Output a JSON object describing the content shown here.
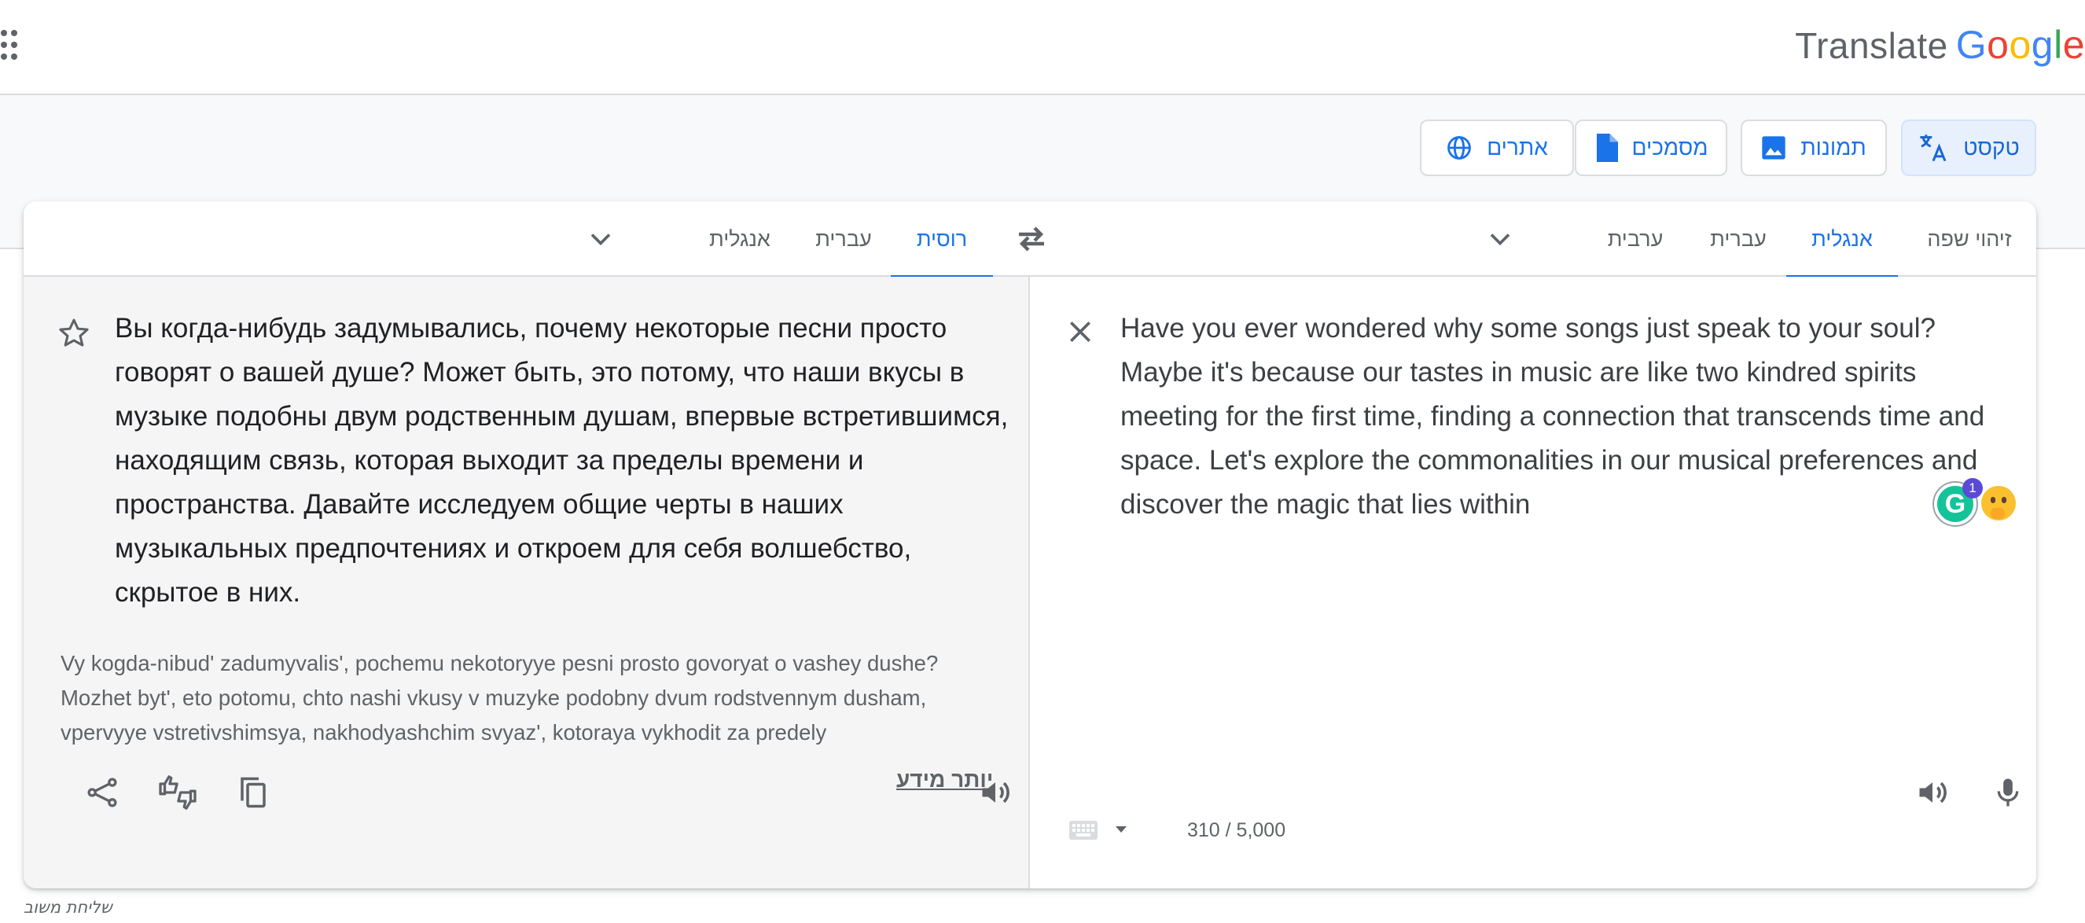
{
  "header": {
    "brand_translate": "Translate",
    "brand_google_letters": [
      "G",
      "o",
      "o",
      "g",
      "l",
      "e"
    ],
    "brand_colors": [
      "#4285f4",
      "#ea4335",
      "#fbbc05",
      "#4285f4",
      "#34a853",
      "#ea4335"
    ]
  },
  "modes": {
    "text": "טקסט",
    "images": "תמונות",
    "documents": "מסמכים",
    "websites": "אתרים"
  },
  "source_langs": {
    "detect": "זיהוי שפה",
    "english": "אנגלית",
    "hebrew": "עברית",
    "arabic": "ערבית"
  },
  "target_langs": {
    "russian": "רוסית",
    "hebrew": "עברית",
    "english": "אנגלית"
  },
  "source": {
    "text": "Have you ever wondered why some songs just speak to your soul? Maybe it's because our tastes in music are like two kindred spirits meeting for the first time, finding a connection that transcends time and space. Let's explore the commonalities in our musical preferences and discover the magic that lies within",
    "char_count": "310 / 5,000",
    "grammarly_count": "1"
  },
  "target": {
    "text": "Вы когда-нибудь задумывались, почему некоторые песни просто говорят о вашей душе? Может быть, это потому, что наши вкусы в музыке подобны двум родственным душам, впервые встретившимся, находящим связь, которая выходит за пределы времени и пространства. Давайте исследуем общие черты в наших музыкальных предпочтениях и откроем для себя волшебство, скрытое в них.",
    "transliteration": "Vy kogda-nibud' zadumyvalis', pochemu nekotoryye pesni prosto govoryat o vashey dushe? Mozhet byt', eto potomu, chto nashi vkusy v muzyke podobny dvum rodstvennym dusham, vpervyye vstretivshimsya, nakhodyashchim svyaz', kotoraya vykhodit za predely",
    "more_link": "יותר מידע"
  },
  "footer": {
    "feedback": "שליחת משוב"
  },
  "colors": {
    "accent": "#1a73e8",
    "active_tab_bg": "#e8f0fe",
    "grammarly": "#15c39a"
  }
}
